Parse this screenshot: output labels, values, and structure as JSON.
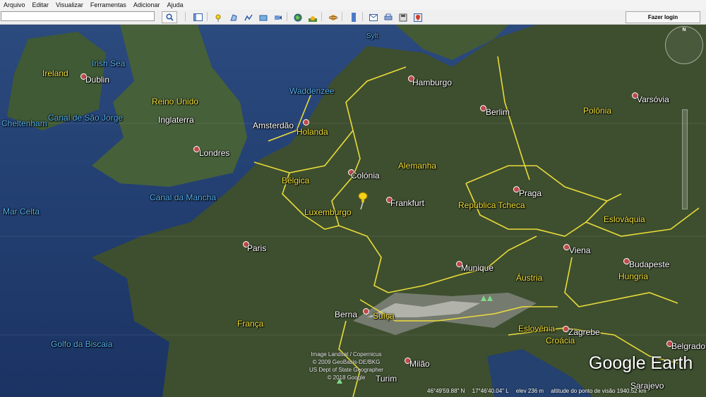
{
  "menu": [
    "Arquivo",
    "Editar",
    "Visualizar",
    "Ferramentas",
    "Adicionar",
    "Ajuda"
  ],
  "search": {
    "value": "",
    "placeholder": ""
  },
  "toolbar": {
    "login_label": "Fazer login"
  },
  "icons": [
    "search-icon",
    "sidebar-icon",
    "placemark-icon",
    "polygon-icon",
    "path-icon",
    "overlay-icon",
    "tour-icon",
    "globe-icon",
    "sun-icon",
    "planet-icon",
    "ruler-icon",
    "email-icon",
    "print-icon",
    "save-image-icon",
    "maps-icon"
  ],
  "map": {
    "countries": [
      "Ireland",
      "Reino Unido",
      "Inglaterra",
      "Holanda",
      "Bélgica",
      "Luxemburgo",
      "Alemanha",
      "Polônia",
      "República Tcheca",
      "Eslováquia",
      "Áustria",
      "Hungria",
      "Suíça",
      "França",
      "Eslovênia",
      "Croácia"
    ],
    "water": [
      "Irish Sea",
      "Waddenzee",
      "Canal de São Jorge",
      "Canal da Mancha",
      "Mar Celta",
      "Golfo da Biscaia",
      "Sylt"
    ],
    "cities": [
      "Dublin",
      "Cheltenham",
      "Londres",
      "Amsterdão",
      "Colónia",
      "Frankfurt",
      "Hamburgo",
      "Berlim",
      "Varsóvia",
      "Praga",
      "Viena",
      "Budapeste",
      "Munique",
      "Paris",
      "Berna",
      "Zagrebe",
      "Belgrado",
      "Milão",
      "Turim",
      "Sarajevo"
    ],
    "attribution": [
      "Image Landsat / Copernicus",
      "© 2009 GeoBasis-DE/BKG",
      "US Dept of State Geographer",
      "© 2018 Google"
    ],
    "logo": "Google Earth",
    "status": {
      "lat": "46°49'59.88\" N",
      "lon": "17°46'40.04\" L",
      "elev": "elev   236 m",
      "alt": "altitude do ponto de visão 1940.52 km"
    },
    "compass_label": "N"
  },
  "colors": {
    "border": "#f2e23a",
    "land_dark": "#3a4a2e",
    "sea": "#1f3a66"
  }
}
